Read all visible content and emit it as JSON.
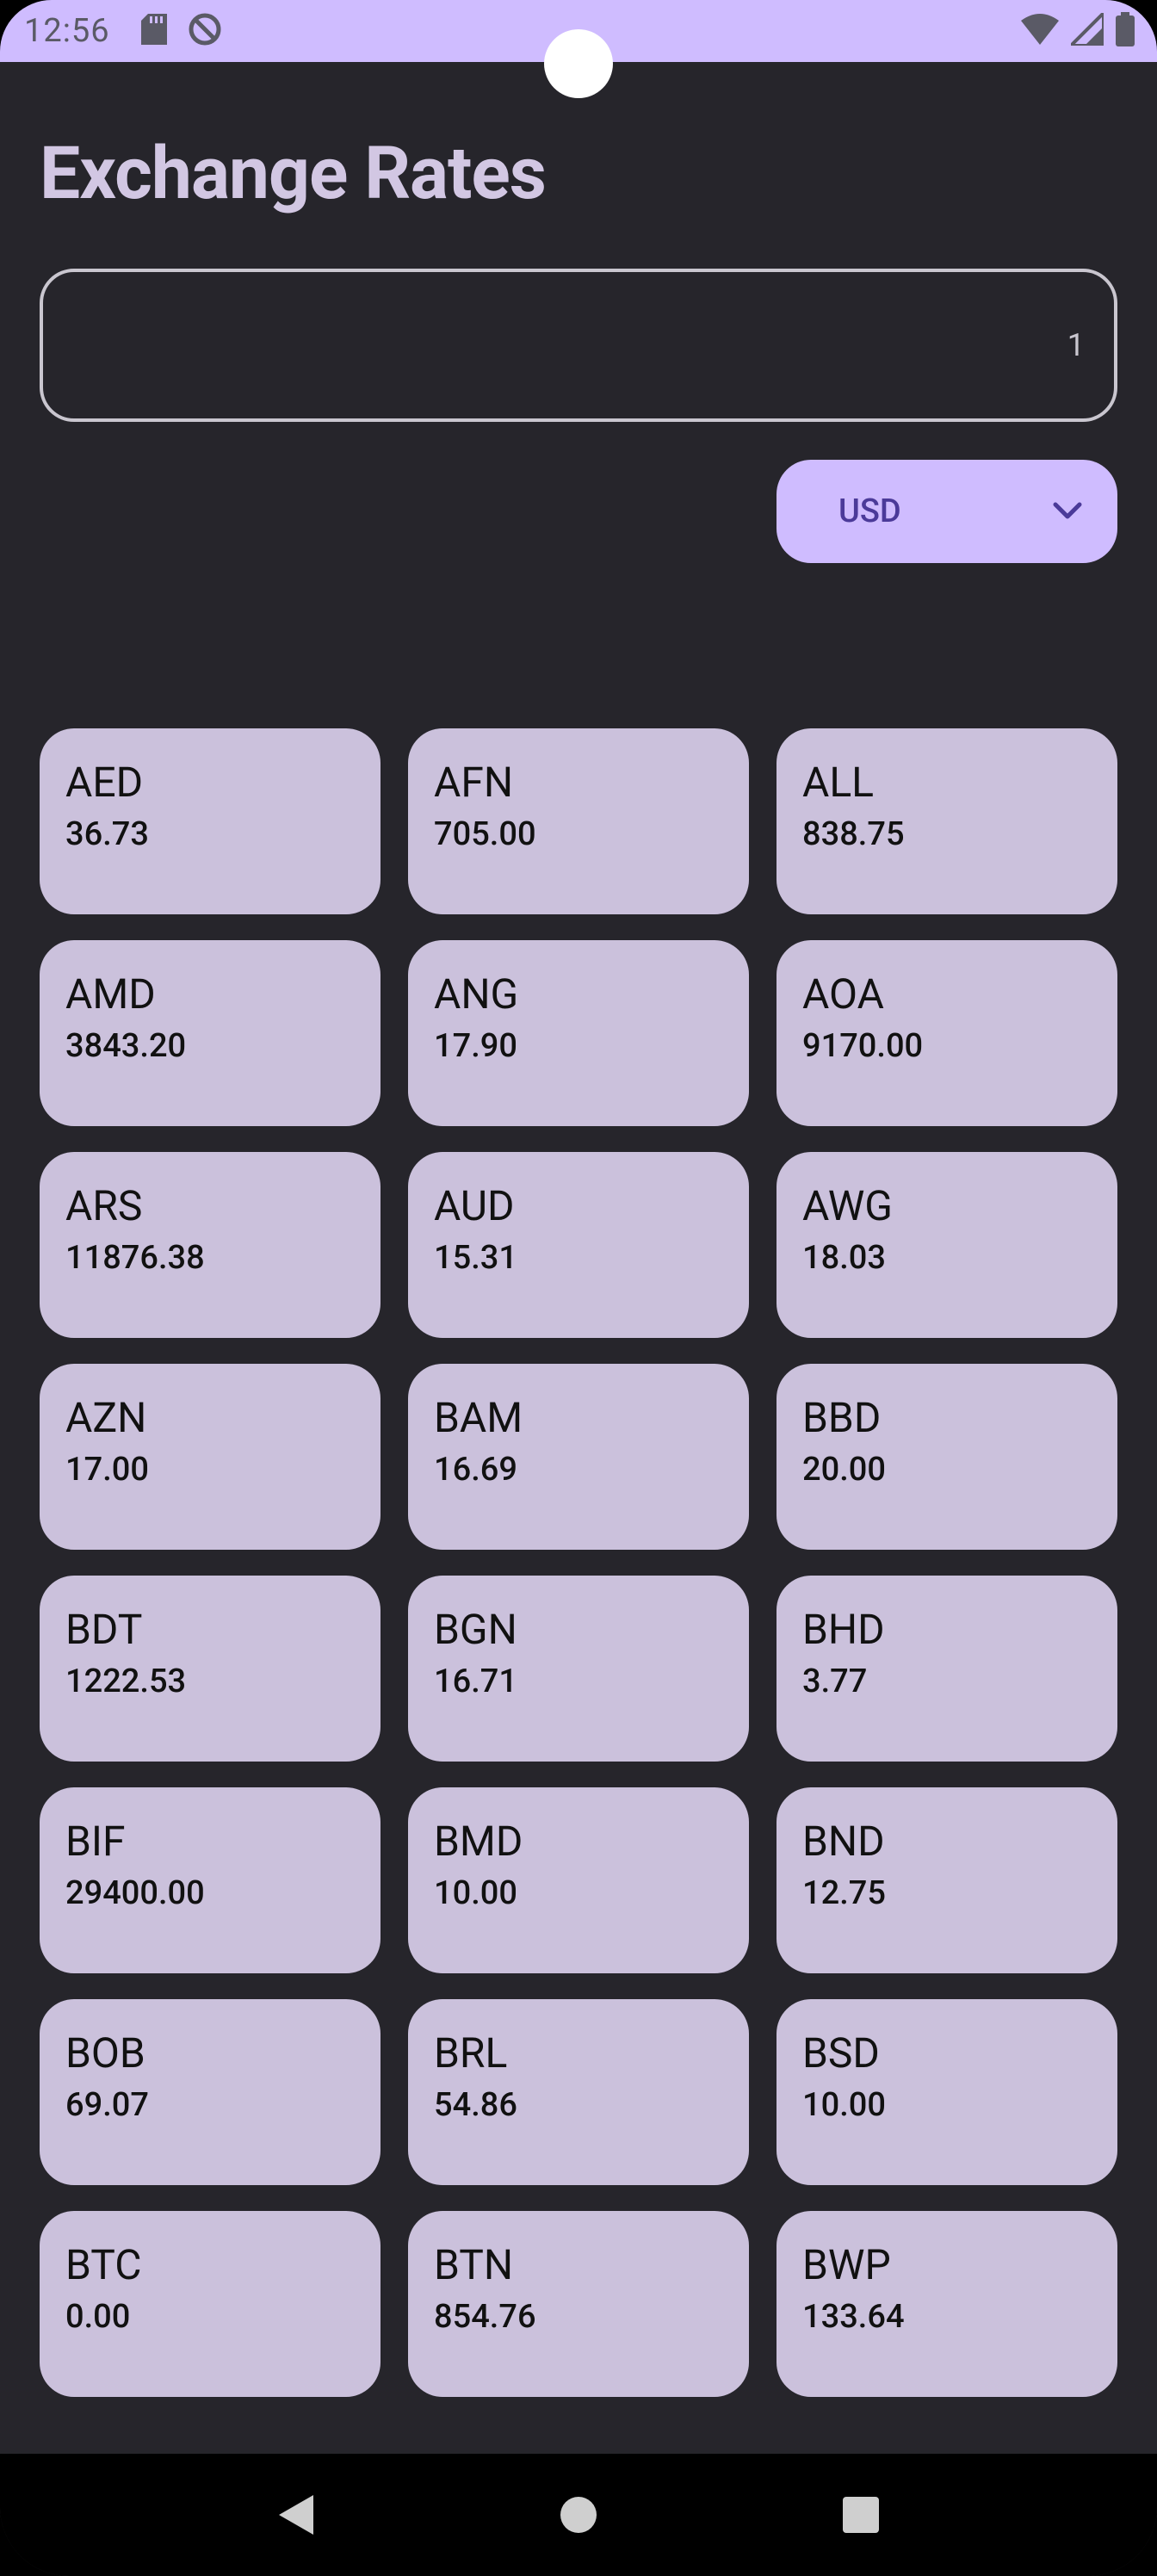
{
  "status_bar": {
    "time": "12:56"
  },
  "app": {
    "title": "Exchange Rates"
  },
  "amount_input": {
    "value": "1"
  },
  "currency_dropdown": {
    "selected": "USD"
  },
  "rates": [
    {
      "code": "AED",
      "rate": "36.73"
    },
    {
      "code": "AFN",
      "rate": "705.00"
    },
    {
      "code": "ALL",
      "rate": "838.75"
    },
    {
      "code": "AMD",
      "rate": "3843.20"
    },
    {
      "code": "ANG",
      "rate": "17.90"
    },
    {
      "code": "AOA",
      "rate": "9170.00"
    },
    {
      "code": "ARS",
      "rate": "11876.38"
    },
    {
      "code": "AUD",
      "rate": "15.31"
    },
    {
      "code": "AWG",
      "rate": "18.03"
    },
    {
      "code": "AZN",
      "rate": "17.00"
    },
    {
      "code": "BAM",
      "rate": "16.69"
    },
    {
      "code": "BBD",
      "rate": "20.00"
    },
    {
      "code": "BDT",
      "rate": "1222.53"
    },
    {
      "code": "BGN",
      "rate": "16.71"
    },
    {
      "code": "BHD",
      "rate": "3.77"
    },
    {
      "code": "BIF",
      "rate": "29400.00"
    },
    {
      "code": "BMD",
      "rate": "10.00"
    },
    {
      "code": "BND",
      "rate": "12.75"
    },
    {
      "code": "BOB",
      "rate": "69.07"
    },
    {
      "code": "BRL",
      "rate": "54.86"
    },
    {
      "code": "BSD",
      "rate": "10.00"
    },
    {
      "code": "BTC",
      "rate": "0.00"
    },
    {
      "code": "BTN",
      "rate": "854.76"
    },
    {
      "code": "BWP",
      "rate": "133.64"
    }
  ],
  "colors": {
    "background": "#26252b",
    "accent": "#cfbcff",
    "card": "#cbc1dc",
    "title": "#d2c7e3"
  }
}
